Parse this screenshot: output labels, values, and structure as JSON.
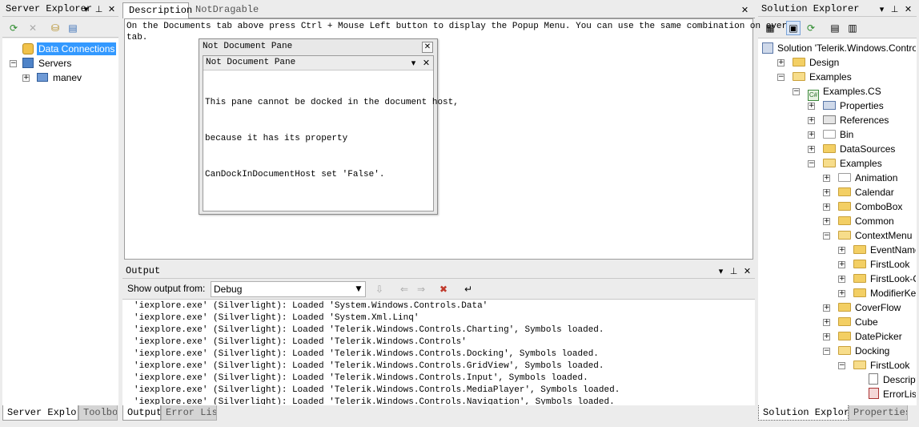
{
  "server_explorer": {
    "title": "Server Explorer",
    "tree": [
      {
        "label": "Data Connections",
        "selected": true
      },
      {
        "label": "Servers"
      },
      {
        "label": "manev"
      }
    ],
    "tabs": [
      "Server Explorer",
      "Toolbox"
    ]
  },
  "documents": {
    "tabs": [
      "Description",
      "NotDragable"
    ],
    "description_text_line1": "On the Documents tab above press Ctrl + Mouse Left button to display the Popup Menu. You can use the same combination on every",
    "description_text_line2": "tab."
  },
  "floating_pane": {
    "window_title": "Not Document Pane",
    "pane_title": "Not Document Pane",
    "body_lines": [
      "This pane cannot be docked in the document host,",
      "because it has its property",
      "CanDockInDocumentHost set 'False'."
    ]
  },
  "output": {
    "title": "Output",
    "show_from_label": "Show output from:",
    "show_from_value": "Debug",
    "lines": [
      "'iexplore.exe' (Silverlight): Loaded 'System.Windows.Controls.Data'",
      "'iexplore.exe' (Silverlight): Loaded 'System.Xml.Linq'",
      "'iexplore.exe' (Silverlight): Loaded 'Telerik.Windows.Controls.Charting', Symbols loaded.",
      "'iexplore.exe' (Silverlight): Loaded 'Telerik.Windows.Controls'",
      "'iexplore.exe' (Silverlight): Loaded 'Telerik.Windows.Controls.Docking', Symbols loaded.",
      "'iexplore.exe' (Silverlight): Loaded 'Telerik.Windows.Controls.GridView', Symbols loaded.",
      "'iexplore.exe' (Silverlight): Loaded 'Telerik.Windows.Controls.Input', Symbols loaded.",
      "'iexplore.exe' (Silverlight): Loaded 'Telerik.Windows.Controls.MediaPlayer', Symbols loaded.",
      "'iexplore.exe' (Silverlight): Loaded 'Telerik.Windows.Controls.Navigation', Symbols loaded."
    ],
    "tabs": [
      "Output",
      "Error List"
    ]
  },
  "solution_explorer": {
    "title": "Solution Explorer",
    "tree": [
      {
        "label": "Solution 'Telerik.Windows.Controls.Examples' (Silverlight)",
        "icon": "solution-icon"
      },
      {
        "label": "Design",
        "icon": "folder-icon"
      },
      {
        "label": "Examples",
        "icon": "folder-open-icon"
      },
      {
        "label": "Examples.CS",
        "icon": "csharp-project-icon"
      },
      {
        "label": "Properties",
        "icon": "properties-icon"
      },
      {
        "label": "References",
        "icon": "references-icon"
      },
      {
        "label": "Bin",
        "icon": "folder-empty-icon"
      },
      {
        "label": "DataSources",
        "icon": "folder-icon"
      },
      {
        "label": "Examples",
        "icon": "folder-open-icon"
      },
      {
        "label": "Animation",
        "icon": "folder-empty-icon"
      },
      {
        "label": "Calendar",
        "icon": "folder-icon"
      },
      {
        "label": "ComboBox",
        "icon": "folder-icon"
      },
      {
        "label": "Common",
        "icon": "folder-icon"
      },
      {
        "label": "ContextMenu",
        "icon": "folder-open-icon"
      },
      {
        "label": "EventName",
        "icon": "folder-icon"
      },
      {
        "label": "FirstLook",
        "icon": "folder-icon"
      },
      {
        "label": "FirstLook-Old",
        "icon": "folder-icon"
      },
      {
        "label": "ModifierKey",
        "icon": "folder-icon"
      },
      {
        "label": "CoverFlow",
        "icon": "folder-icon"
      },
      {
        "label": "Cube",
        "icon": "folder-icon"
      },
      {
        "label": "DatePicker",
        "icon": "folder-icon"
      },
      {
        "label": "Docking",
        "icon": "folder-open-icon"
      },
      {
        "label": "FirstLook",
        "icon": "folder-open-icon"
      },
      {
        "label": "Description.xaml",
        "icon": "xaml-file-icon"
      },
      {
        "label": "ErrorList.png",
        "icon": "image-file-icon"
      }
    ],
    "tabs": [
      "Solution Explorer",
      "Properties"
    ]
  },
  "colors": {
    "selection": "#3399ff",
    "panel_bg": "#ececec",
    "border": "#9c9c9c"
  }
}
